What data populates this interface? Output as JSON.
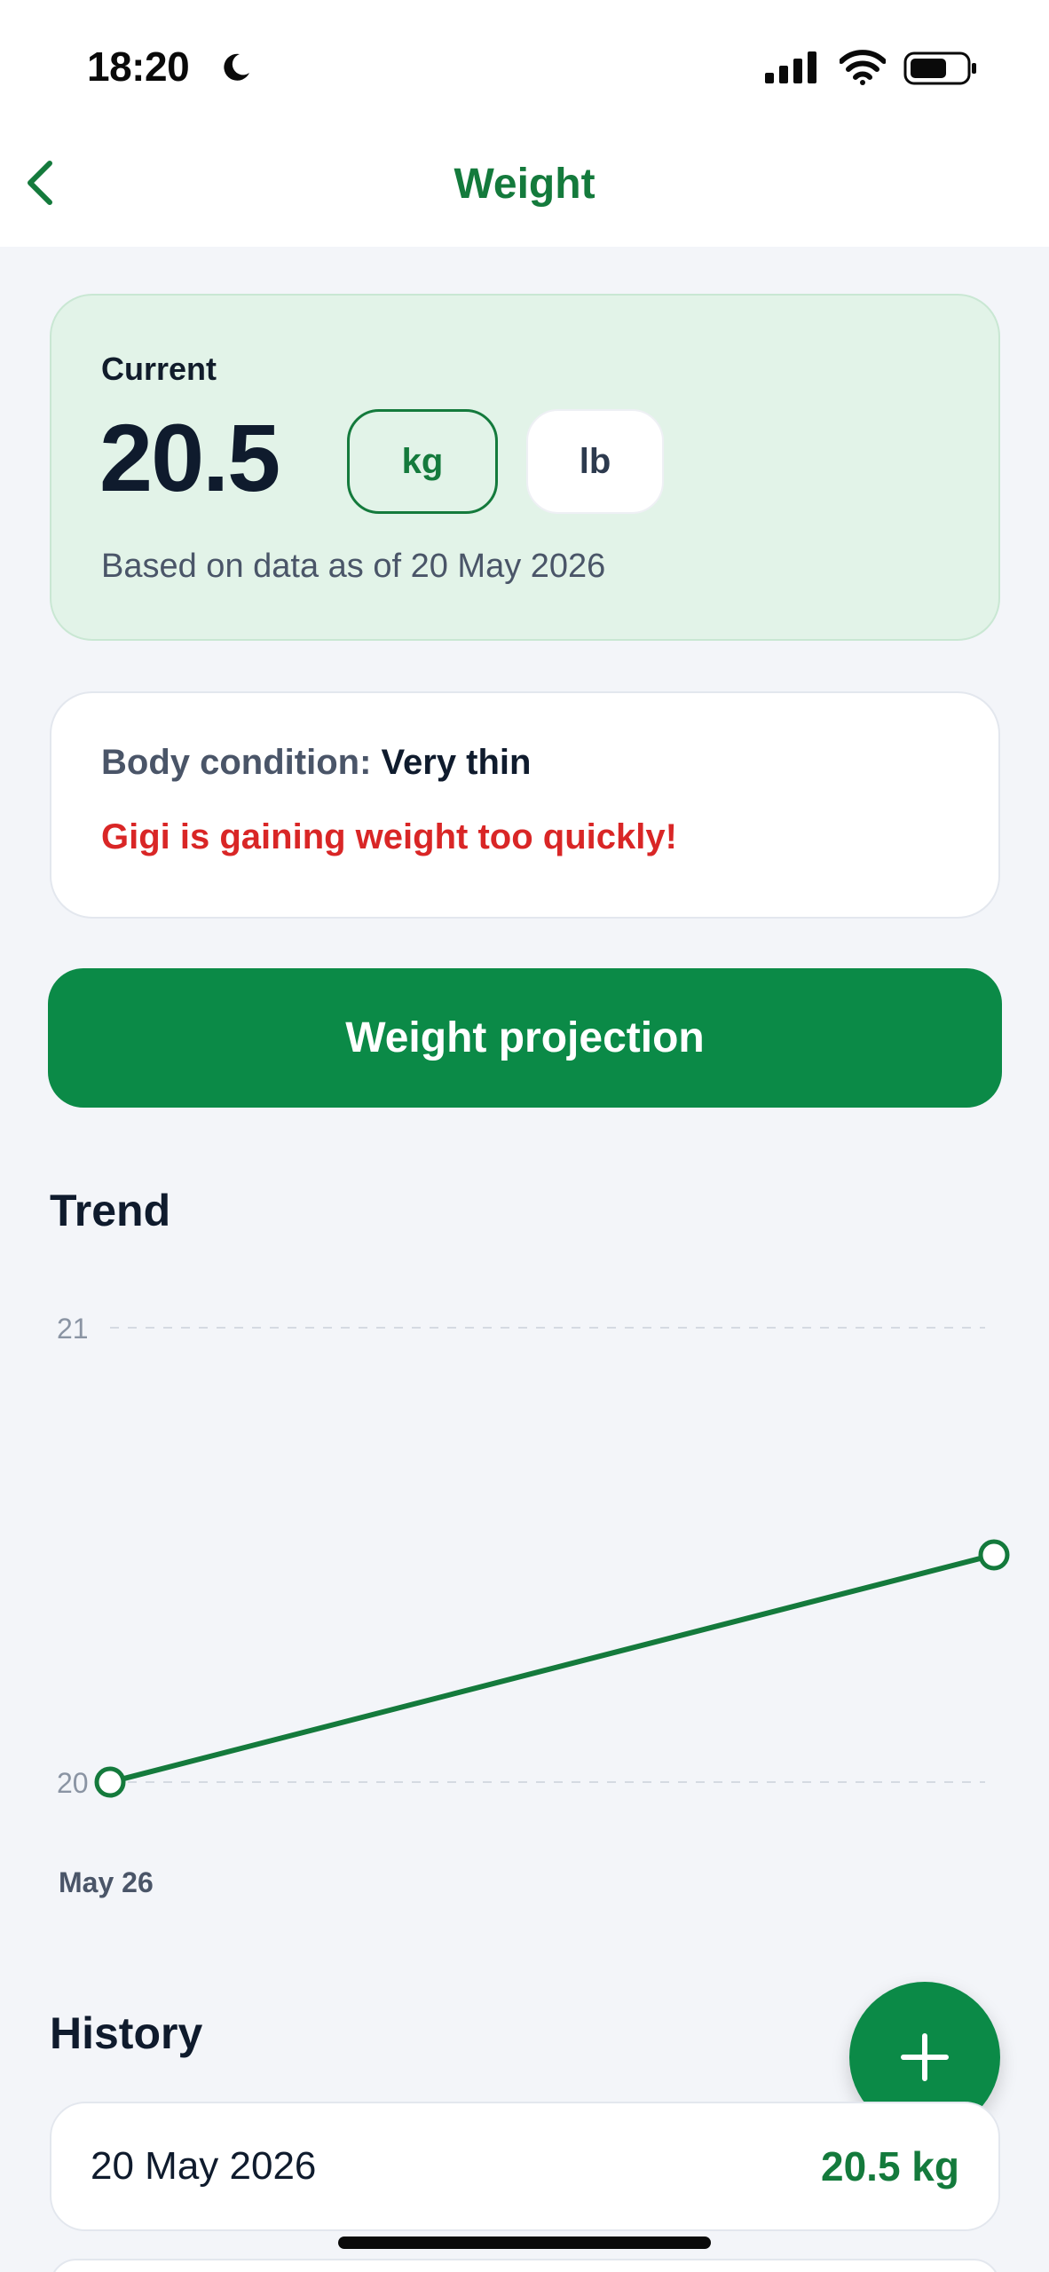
{
  "status_bar": {
    "time": "18:20",
    "icons": [
      "moon-icon",
      "signal-icon",
      "wifi-icon",
      "battery-icon"
    ]
  },
  "nav": {
    "title": "Weight",
    "back_icon": "chevron-left-icon"
  },
  "current": {
    "label": "Current",
    "value": "20.5",
    "units": [
      "kg",
      "lb"
    ],
    "selected_unit": "kg",
    "based_on": "Based on data as of 20 May 2026"
  },
  "condition": {
    "label": "Body condition:",
    "value": "Very thin",
    "warning": "Gigi is gaining weight too quickly!"
  },
  "projection_button": "Weight projection",
  "trend": {
    "title": "Trend"
  },
  "chart_data": {
    "type": "line",
    "title": "Trend",
    "xlabel": "",
    "ylabel": "",
    "ylim": [
      20,
      21
    ],
    "y_ticks": [
      "21",
      "20"
    ],
    "x_tick_labels": [
      "May 26"
    ],
    "series": [
      {
        "values": [
          20.0,
          20.5
        ]
      }
    ],
    "grid": true,
    "color": "#147a3c"
  },
  "history": {
    "title": "History",
    "add_icon": "plus-icon",
    "rows": [
      {
        "date": "20 May 2026",
        "value": "20.5 kg"
      }
    ]
  },
  "colors": {
    "accent": "#147a3c",
    "button": "#0b8a47",
    "warning": "#d92626",
    "card_green": "#e2f3e8"
  }
}
